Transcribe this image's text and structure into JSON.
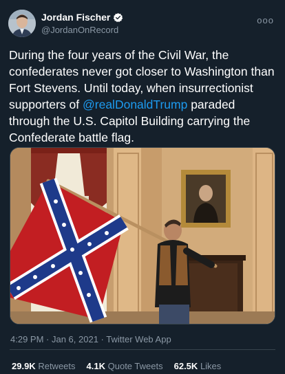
{
  "author": {
    "display_name": "Jordan Fischer",
    "handle": "@JordanOnRecord",
    "verified_icon": "verified-badge-icon"
  },
  "more_icon": "more-dots-icon",
  "more_label": "ooo",
  "tweet": {
    "text_before": "During the four years of the Civil War, the confederates never got closer to Washington than Fort Stevens. Until today, when insurrectionist supporters of ",
    "mention": "@realDonaldTrump",
    "text_after": " paraded through the U.S. Capitol Building carrying the Confederate battle flag."
  },
  "meta": {
    "time": "4:29 PM",
    "date": "Jan 6, 2021",
    "client": "Twitter Web App",
    "separator": " · "
  },
  "stats": {
    "retweets_count": "29.9K",
    "retweets_label": "Retweets",
    "quotes_count": "4.1K",
    "quotes_label": "Quote Tweets",
    "likes_count": "62.5K",
    "likes_label": "Likes"
  },
  "colors": {
    "background": "#15202b",
    "accent": "#1d9bf0",
    "secondary_text": "#8b98a5"
  }
}
